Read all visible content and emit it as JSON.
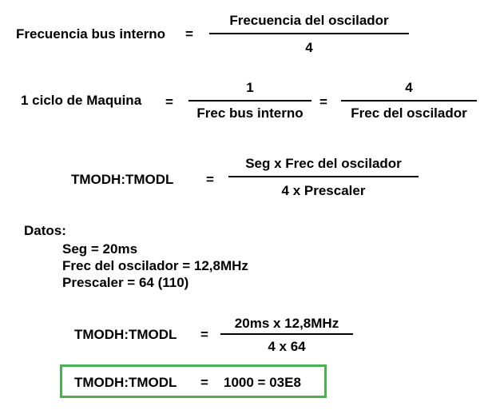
{
  "eq1": {
    "lhs": "Frecuencia bus interno",
    "eq": "=",
    "num": "Frecuencia del oscilador",
    "den": "4"
  },
  "eq2": {
    "lhs": "1 ciclo de Maquina",
    "eq1": "=",
    "num1": "1",
    "den1": "Frec bus interno",
    "eq2": "=",
    "num2": "4",
    "den2": "Frec del oscilador"
  },
  "eq3": {
    "lhs": "TMODH:TMODL",
    "eq": "=",
    "num": "Seg x Frec del oscilador",
    "den": "4 x Prescaler"
  },
  "datos": {
    "title": "Datos:",
    "items": [
      "Seg = 20ms",
      "Frec del oscilador = 12,8MHz",
      "Prescaler = 64 (110)"
    ]
  },
  "eq4": {
    "lhs": "TMODH:TMODL",
    "eq": "=",
    "num": "20ms x 12,8MHz",
    "den": "4 x 64"
  },
  "result": {
    "lhs": "TMODH:TMODL",
    "eq": "=",
    "value": "1000 = 03E8",
    "border_color": "#4caf50"
  }
}
